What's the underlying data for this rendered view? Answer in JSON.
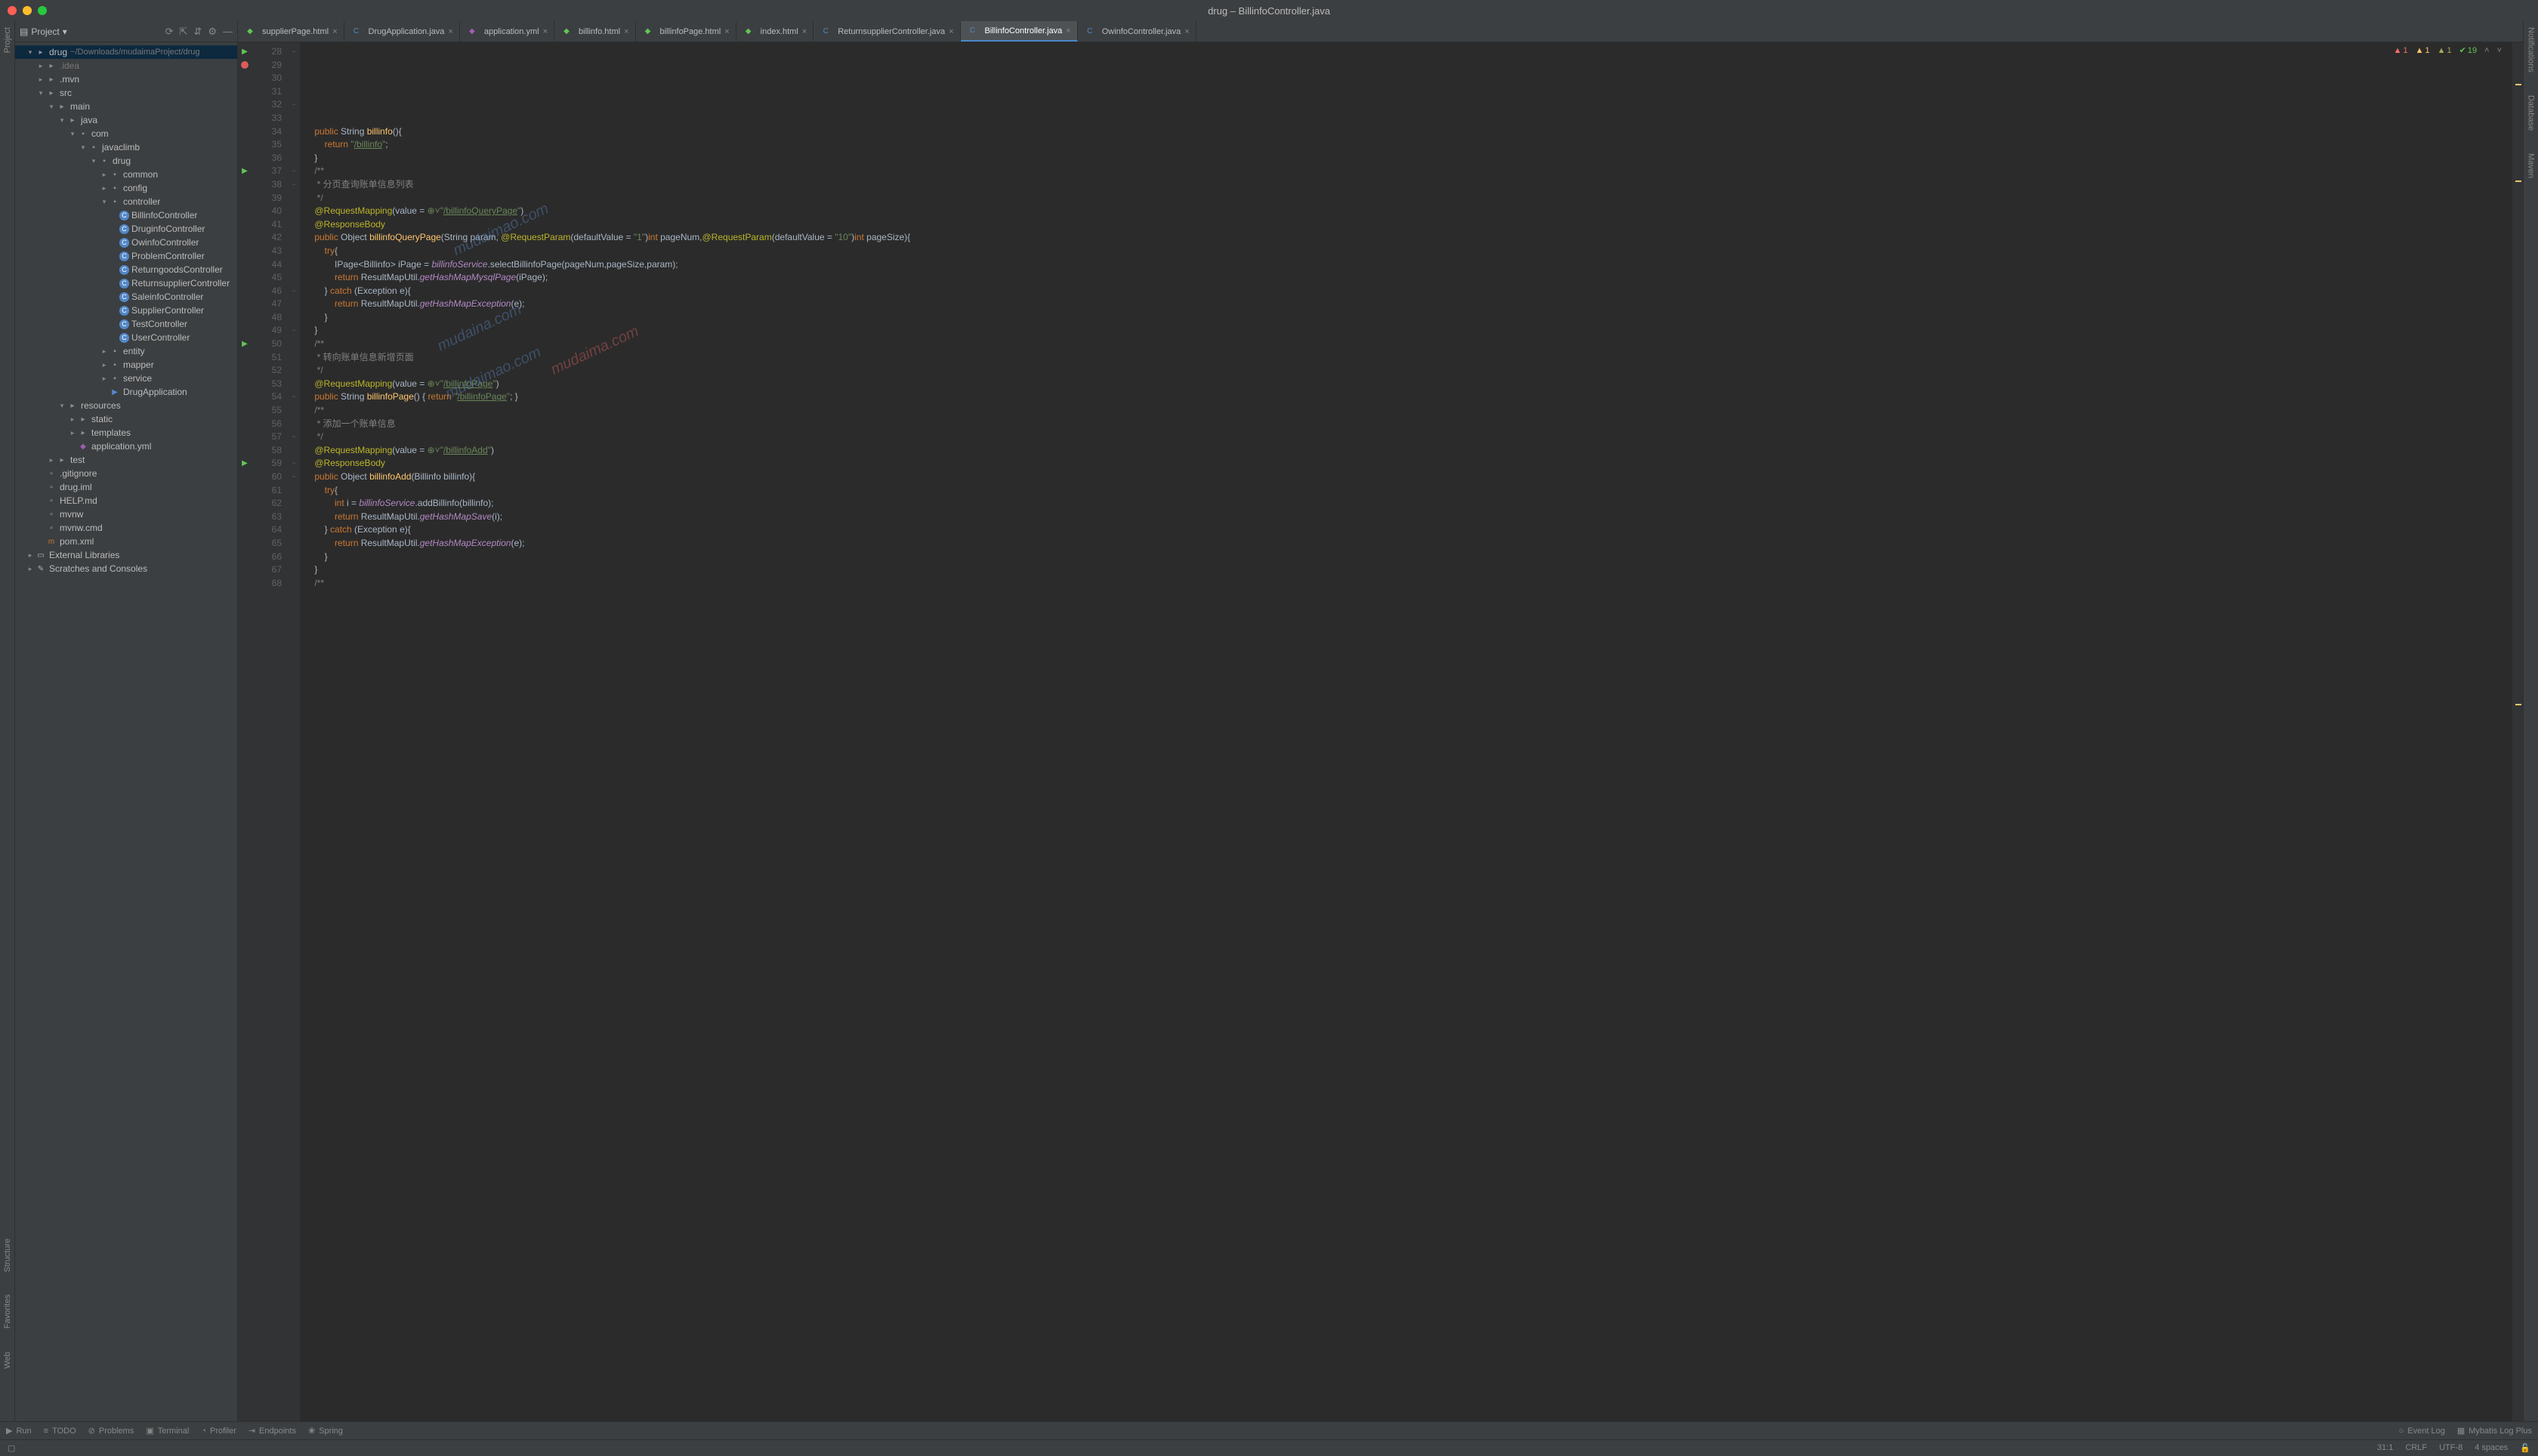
{
  "window": {
    "title": "drug – BillinfoController.java"
  },
  "sidebar": {
    "header": "Project",
    "icons": [
      "⟳",
      "⇱",
      "⇵",
      "⚙",
      "—"
    ],
    "root": {
      "name": "drug",
      "path": "~/Downloads/mudaimaProject/drug"
    },
    "tree": [
      {
        "d": 1,
        "a": "▾",
        "i": "folder",
        "l": "drug",
        "path": "~/Downloads/mudaimaProject/drug",
        "sel": true
      },
      {
        "d": 2,
        "a": "▸",
        "i": "folder",
        "l": ".idea",
        "dim": true
      },
      {
        "d": 2,
        "a": "▸",
        "i": "folder",
        "l": ".mvn"
      },
      {
        "d": 2,
        "a": "▾",
        "i": "folder",
        "l": "src"
      },
      {
        "d": 3,
        "a": "▾",
        "i": "folder",
        "l": "main"
      },
      {
        "d": 4,
        "a": "▾",
        "i": "folder",
        "l": "java"
      },
      {
        "d": 5,
        "a": "▾",
        "i": "pkg",
        "l": "com"
      },
      {
        "d": 6,
        "a": "▾",
        "i": "pkg",
        "l": "javaclimb"
      },
      {
        "d": 7,
        "a": "▾",
        "i": "pkg",
        "l": "drug"
      },
      {
        "d": 8,
        "a": "▸",
        "i": "pkg",
        "l": "common"
      },
      {
        "d": 8,
        "a": "▸",
        "i": "pkg",
        "l": "config"
      },
      {
        "d": 8,
        "a": "▾",
        "i": "pkg",
        "l": "controller"
      },
      {
        "d": 9,
        "a": "",
        "i": "cls",
        "l": "BillinfoController"
      },
      {
        "d": 9,
        "a": "",
        "i": "cls",
        "l": "DruginfoController"
      },
      {
        "d": 9,
        "a": "",
        "i": "cls",
        "l": "OwinfoController"
      },
      {
        "d": 9,
        "a": "",
        "i": "cls",
        "l": "ProblemController"
      },
      {
        "d": 9,
        "a": "",
        "i": "cls",
        "l": "ReturngoodsController"
      },
      {
        "d": 9,
        "a": "",
        "i": "cls",
        "l": "ReturnsupplierController"
      },
      {
        "d": 9,
        "a": "",
        "i": "cls",
        "l": "SaleinfoController"
      },
      {
        "d": 9,
        "a": "",
        "i": "cls",
        "l": "SupplierController"
      },
      {
        "d": 9,
        "a": "",
        "i": "cls",
        "l": "TestController"
      },
      {
        "d": 9,
        "a": "",
        "i": "cls",
        "l": "UserController"
      },
      {
        "d": 8,
        "a": "▸",
        "i": "pkg",
        "l": "entity"
      },
      {
        "d": 8,
        "a": "▸",
        "i": "pkg",
        "l": "mapper"
      },
      {
        "d": 8,
        "a": "▸",
        "i": "pkg",
        "l": "service"
      },
      {
        "d": 8,
        "a": "",
        "i": "java",
        "l": "DrugApplication"
      },
      {
        "d": 4,
        "a": "▾",
        "i": "res",
        "l": "resources"
      },
      {
        "d": 5,
        "a": "▸",
        "i": "folder",
        "l": "static"
      },
      {
        "d": 5,
        "a": "▸",
        "i": "folder",
        "l": "templates"
      },
      {
        "d": 5,
        "a": "",
        "i": "yml",
        "l": "application.yml"
      },
      {
        "d": 3,
        "a": "▸",
        "i": "folder",
        "l": "test"
      },
      {
        "d": 2,
        "a": "",
        "i": "file",
        "l": ".gitignore"
      },
      {
        "d": 2,
        "a": "",
        "i": "file",
        "l": "drug.iml"
      },
      {
        "d": 2,
        "a": "",
        "i": "file",
        "l": "HELP.md"
      },
      {
        "d": 2,
        "a": "",
        "i": "file",
        "l": "mvnw"
      },
      {
        "d": 2,
        "a": "",
        "i": "file",
        "l": "mvnw.cmd"
      },
      {
        "d": 2,
        "a": "",
        "i": "xml",
        "l": "pom.xml"
      },
      {
        "d": 1,
        "a": "▸",
        "i": "lib",
        "l": "External Libraries"
      },
      {
        "d": 1,
        "a": "▸",
        "i": "scr",
        "l": "Scratches and Consoles"
      }
    ]
  },
  "leftRail": [
    "Project",
    "Structure",
    "Favorites",
    "Web"
  ],
  "rightRail": [
    "Notifications",
    "Database",
    "Maven"
  ],
  "tabs": [
    {
      "l": "supplierPage.html",
      "t": "html"
    },
    {
      "l": "DrugApplication.java",
      "t": "cls"
    },
    {
      "l": "application.yml",
      "t": "yml"
    },
    {
      "l": "billinfo.html",
      "t": "html"
    },
    {
      "l": "billinfoPage.html",
      "t": "html"
    },
    {
      "l": "index.html",
      "t": "html"
    },
    {
      "l": "ReturnsupplierController.java",
      "t": "cls"
    },
    {
      "l": "BillinfoController.java",
      "t": "cls",
      "active": true
    },
    {
      "l": "OwinfoController.java",
      "t": "cls"
    }
  ],
  "inspections": {
    "err": "1",
    "warn1": "1",
    "warn2": "1",
    "ok": "19"
  },
  "gutterStart": 28,
  "gutterEnd": 68,
  "gutterMarks": {
    "29": "bp",
    "28": "run",
    "37": "run",
    "50": "run",
    "59": "run"
  },
  "code": [
    "    <span class='kw'>public</span> String <span class='fn'>billinfo</span>(){",
    "        <span class='kw'>return</span> <span class='str'>\"<span class='und'>/billinfo</span>\"</span>;",
    "    }",
    "",
    "    <span class='cmt'>/**</span>",
    "<span class='cmt'>     * 分页查询账单信息列表</span>",
    "<span class='cmt'>     */</span>",
    "    <span class='ann'>@RequestMapping</span>(value = <span class='str'>⊕˅\"<span class='und'>/billinfoQueryPage</span>\"</span>)",
    "    <span class='ann'>@ResponseBody</span>",
    "    <span class='kw'>public</span> Object <span class='fn'>billinfoQueryPage</span>(String param, <span class='ann'>@RequestParam</span>(defaultValue = <span class='str'>\"1\"</span>)<span class='kw'>int</span> pageNum,<span class='ann'>@RequestParam</span>(defaultValue = <span class='str'>\"10\"</span>)<span class='kw'>int</span> pageSize){",
    "        <span class='kw'>try</span>{",
    "            IPage&lt;Billinfo&gt; iPage = <span class='it'>billinfoService</span>.selectBillinfoPage(pageNum,pageSize,param);",
    "            <span class='kw'>return</span> ResultMapUtil.<span class='it'>getHashMapMysqlPage</span>(iPage);",
    "        } <span class='kw'>catch</span> (Exception e){",
    "            <span class='kw'>return</span> ResultMapUtil.<span class='it'>getHashMapException</span>(e);",
    "        }",
    "    }",
    "",
    "    <span class='cmt'>/**</span>",
    "<span class='cmt'>     * 转向账单信息新增页面</span>",
    "<span class='cmt'>     */</span>",
    "    <span class='ann'>@RequestMapping</span>(value = <span class='str'>⊕˅\"<span class='und'>/billinfoPage</span>\"</span>)",
    "    <span class='kw'>public</span> String <span class='fn'>billinfoPage</span>() { <span class='kw'>return</span> <span class='str'>\"<span class='und'>/billinfoPage</span>\"</span>; }",
    "",
    "",
    "    <span class='cmt'>/**</span>",
    "<span class='cmt'>     * 添加一个账单信息</span>",
    "<span class='cmt'>     */</span>",
    "    <span class='ann'>@RequestMapping</span>(value = <span class='str'>⊕˅\"<span class='und'>/billinfoAdd</span>\"</span>)",
    "    <span class='ann'>@ResponseBody</span>",
    "    <span class='kw'>public</span> Object <span class='fn'>billinfoAdd</span>(Billinfo billinfo){",
    "        <span class='kw'>try</span>{",
    "            <span class='kw'>int</span> i = <span class='it'>billinfoService</span>.addBillinfo(billinfo);",
    "            <span class='kw'>return</span> ResultMapUtil.<span class='it'>getHashMapSave</span>(i);",
    "        } <span class='kw'>catch</span> (Exception e){",
    "            <span class='kw'>return</span> ResultMapUtil.<span class='it'>getHashMapException</span>(e);",
    "        }",
    "    }",
    "",
    "    <span class='cmt'>/**</span>"
  ],
  "bottom": {
    "items": [
      {
        "i": "▶",
        "l": "Run"
      },
      {
        "i": "≡",
        "l": "TODO"
      },
      {
        "i": "⊘",
        "l": "Problems"
      },
      {
        "i": "▣",
        "l": "Terminal"
      },
      {
        "i": "◔",
        "l": "Profiler"
      },
      {
        "i": "⇥",
        "l": "Endpoints"
      },
      {
        "i": "❀",
        "l": "Spring"
      }
    ],
    "right": [
      {
        "i": "○",
        "l": "Event Log"
      },
      {
        "i": "▦",
        "l": "Mybatis Log Plus"
      }
    ]
  },
  "status": {
    "pos": "31:1",
    "le": "CRLF",
    "enc": "UTF-8",
    "ind": "4 spaces",
    "lock": "🔓"
  },
  "watermarks": [
    "mudaimao.com",
    "mudaina.com",
    "mudaimao.com",
    "mudaima.com"
  ]
}
